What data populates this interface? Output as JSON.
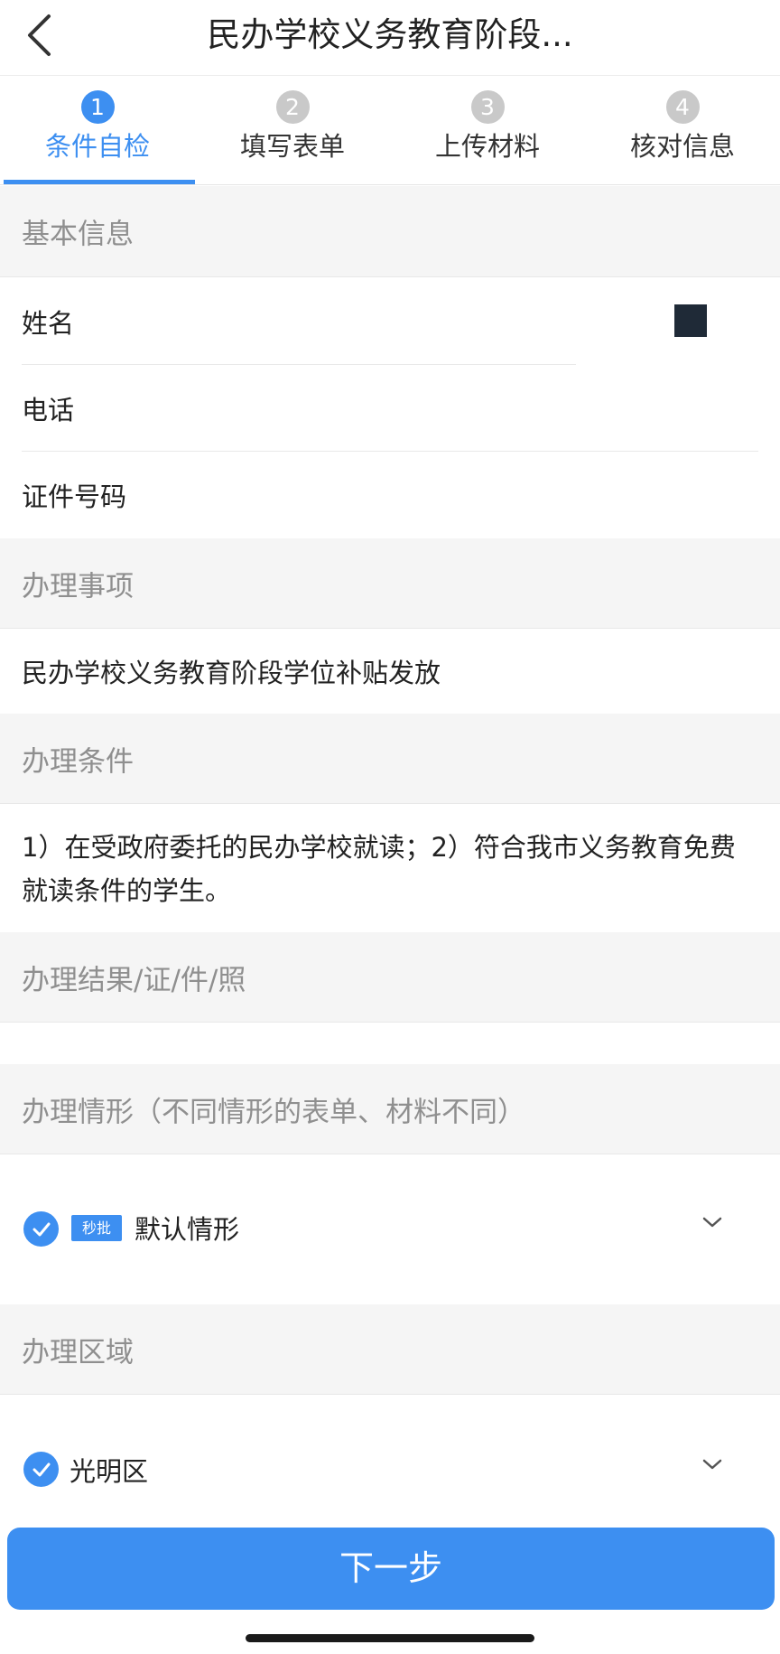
{
  "header": {
    "title": "民办学校义务教育阶段..."
  },
  "steps": [
    {
      "num": "1",
      "label": "条件自检"
    },
    {
      "num": "2",
      "label": "填写表单"
    },
    {
      "num": "3",
      "label": "上传材料"
    },
    {
      "num": "4",
      "label": "核对信息"
    }
  ],
  "basic_info": {
    "title": "基本信息",
    "fields": [
      {
        "label": "姓名"
      },
      {
        "label": "电话"
      },
      {
        "label": "证件号码"
      }
    ]
  },
  "matter": {
    "title": "办理事项",
    "value": "民办学校义务教育阶段学位补贴发放"
  },
  "conditions": {
    "title": "办理条件",
    "text": "1）在受政府委托的民办学校就读；2）符合我市义务教育免费就读条件的学生。"
  },
  "result": {
    "title": "办理结果/证/件/照"
  },
  "situation": {
    "title": "办理情形（不同情形的表单、材料不同）",
    "badge": "秒批",
    "selected": "默认情形"
  },
  "area": {
    "title": "办理区域",
    "selected": "光明区"
  },
  "footer": {
    "next_label": "下一步"
  },
  "colors": {
    "accent": "#3d8ff1",
    "section_bg": "#f5f5f5",
    "section_text": "#8f8f8f"
  }
}
